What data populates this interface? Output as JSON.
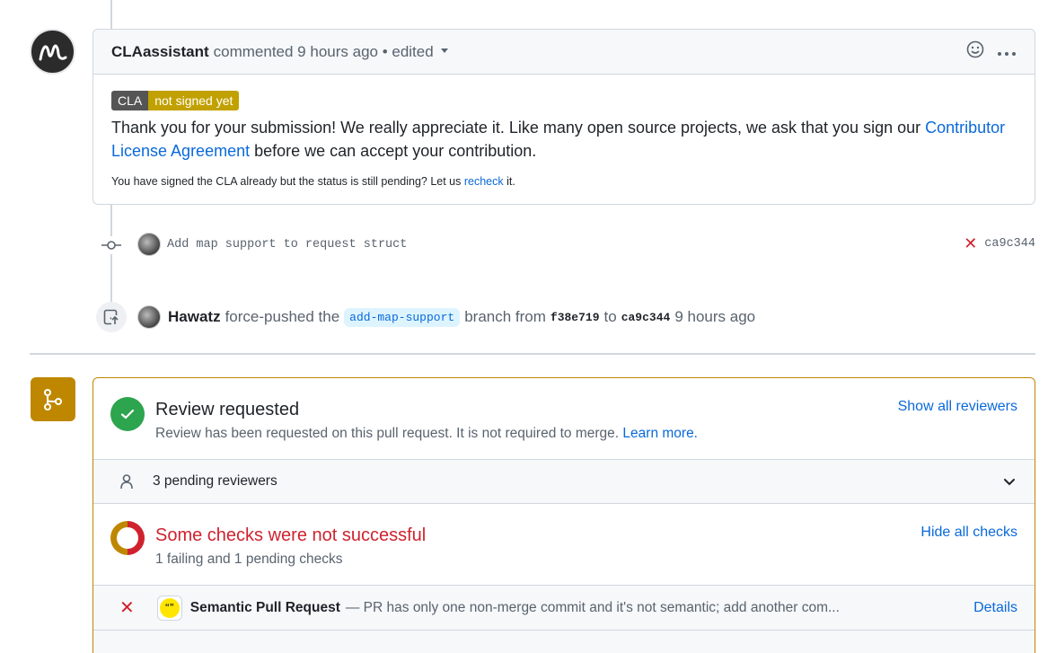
{
  "comment": {
    "author": "CLAassistant",
    "meta": "commented 9 hours ago • edited",
    "badge_left": "CLA",
    "badge_right": "not signed yet",
    "body_pre": "Thank you for your submission! We really appreciate it. Like many open source projects, we ask that you sign our ",
    "body_link": "Contributor License Agreement",
    "body_post": " before we can accept your contribution.",
    "small_pre": "You have signed the CLA already but the status is still pending? Let us ",
    "small_link": "recheck",
    "small_post": " it."
  },
  "commit": {
    "message": "Add map support to request struct",
    "status": "failure",
    "sha": "ca9c344"
  },
  "force_push": {
    "author": "Hawatz",
    "action": "force-pushed the",
    "branch": "add-map-support",
    "from_word": "branch from",
    "from_sha": "f38e719",
    "to_word": "to",
    "to_sha": "ca9c344",
    "time": "9 hours ago"
  },
  "merge_box": {
    "review": {
      "title": "Review requested",
      "subtitle": "Review has been requested on this pull request. It is not required to merge.",
      "learn_more": "Learn more.",
      "link": "Show all reviewers"
    },
    "pending_reviewers": "3 pending reviewers",
    "checks": {
      "title": "Some checks were not successful",
      "subtitle": "1 failing and 1 pending checks",
      "link": "Hide all checks"
    },
    "check_items": [
      {
        "name": "Semantic Pull Request",
        "description": "— PR has only one non-merge commit and it's not semantic; add another com...",
        "details": "Details",
        "badge_text": "“”"
      }
    ]
  },
  "colors": {
    "link": "#0969da",
    "danger": "#cf222e",
    "attention": "#bf8700",
    "success": "#2da44e"
  }
}
